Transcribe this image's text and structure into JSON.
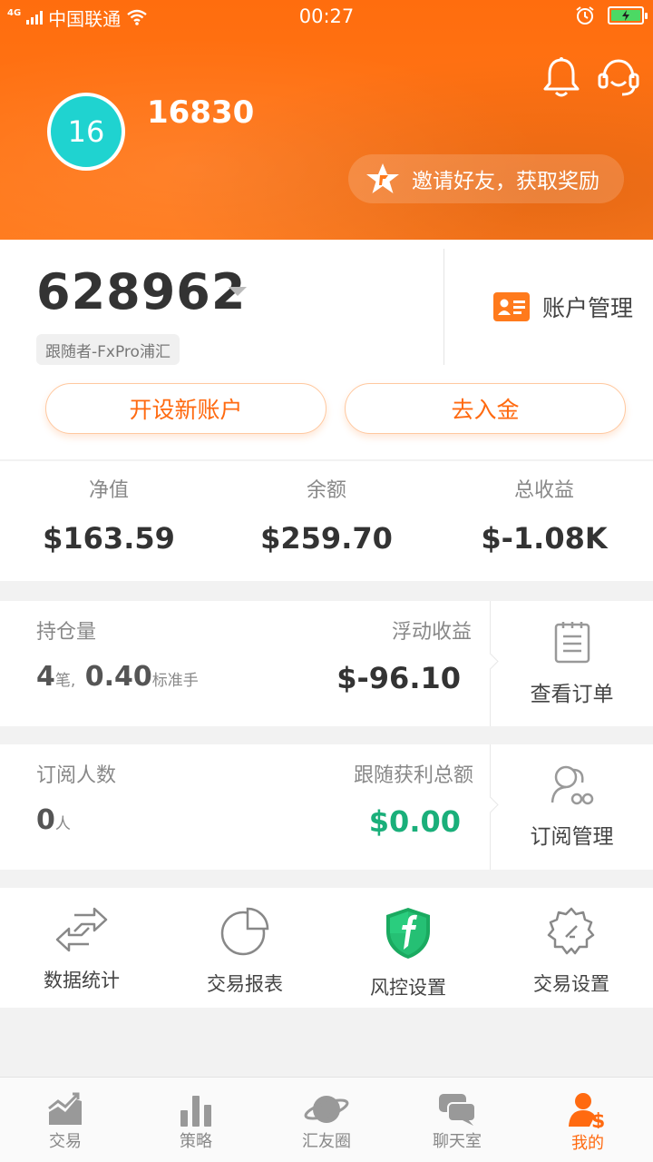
{
  "status_bar": {
    "network": "4G",
    "carrier": "中国联通",
    "time": "00:27"
  },
  "header": {
    "avatar_text": "16",
    "username": "16830",
    "invite_label": "邀请好友，获取奖励",
    "icons": [
      "bell-icon",
      "customer-service-icon",
      "alarm-icon",
      "battery-icon"
    ]
  },
  "account": {
    "number": "628962",
    "tag": "跟随者-FxPro浦汇",
    "manage_label": "账户管理",
    "open_account_label": "开设新账户",
    "deposit_label": "去入金"
  },
  "stats": [
    {
      "label": "净值",
      "value": "$163.59"
    },
    {
      "label": "余额",
      "value": "$259.70"
    },
    {
      "label": "总收益",
      "value": "$-1.08K"
    }
  ],
  "positions": {
    "label_hold": "持仓量",
    "count": "4",
    "count_unit": "笔,",
    "lots": "0.40",
    "lots_unit": "标准手",
    "label_float": "浮动收益",
    "float_value": "$-96.10",
    "side_label": "查看订单"
  },
  "subscribers": {
    "label_count": "订阅人数",
    "count": "0",
    "count_unit": "人",
    "label_profit": "跟随获利总额",
    "profit_value": "$0.00",
    "profit_color": "#1aaf7a",
    "side_label": "订阅管理"
  },
  "tools": [
    {
      "label": "数据统计",
      "icon": "exchange-arrows-icon"
    },
    {
      "label": "交易报表",
      "icon": "pie-chart-icon"
    },
    {
      "label": "风控设置",
      "icon": "shield-icon"
    },
    {
      "label": "交易设置",
      "icon": "gear-icon"
    }
  ],
  "nav": [
    {
      "label": "交易",
      "icon": "trend-chart-icon",
      "active": false
    },
    {
      "label": "策略",
      "icon": "bar-chart-icon",
      "active": false
    },
    {
      "label": "汇友圈",
      "icon": "planet-icon",
      "active": false
    },
    {
      "label": "聊天室",
      "icon": "chat-bubbles-icon",
      "active": false
    },
    {
      "label": "我的",
      "icon": "user-dollar-icon",
      "active": true
    }
  ],
  "colors": {
    "brand_orange": "#ff6d0e",
    "avatar_teal": "#1fd3d0",
    "profit_green": "#1aaf7a"
  }
}
